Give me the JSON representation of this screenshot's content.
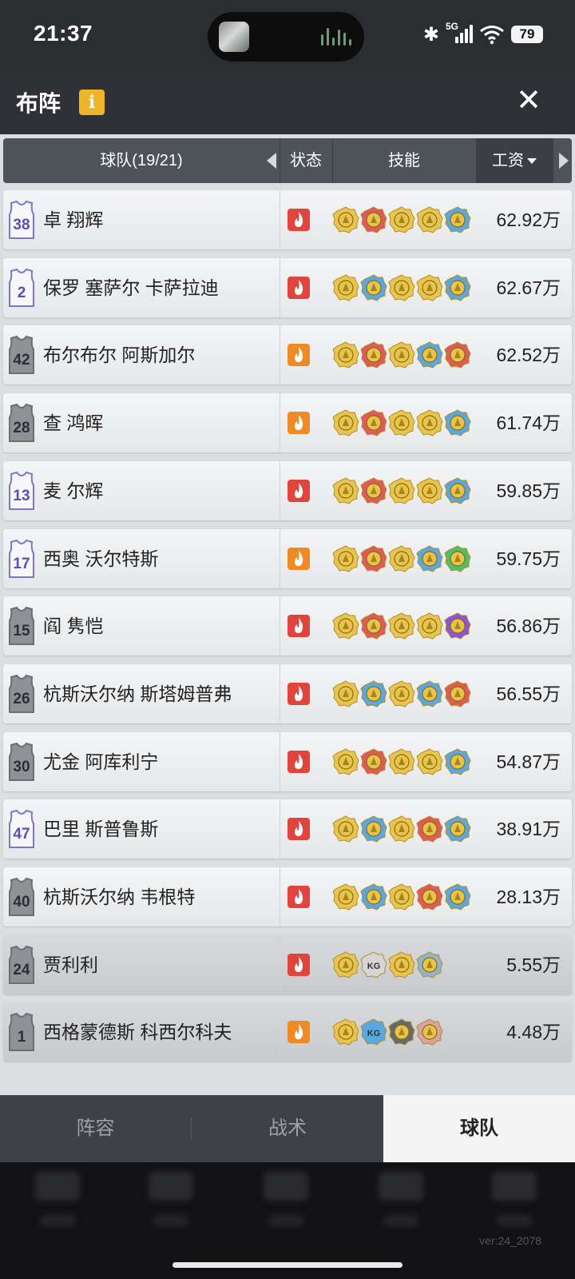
{
  "status": {
    "time": "21:37",
    "network": "5G",
    "battery": "79"
  },
  "header": {
    "title": "布阵",
    "info_label": "i"
  },
  "columns": {
    "team": "球队(19/21)",
    "state": "状态",
    "skill": "技能",
    "salary": "工资"
  },
  "players": [
    {
      "number": "38",
      "jersey": "white",
      "name": "卓 翔辉",
      "state": "red",
      "skills": [
        "gold",
        "red",
        "gold",
        "gold",
        "blue"
      ],
      "salary": "62.92万",
      "dim": false
    },
    {
      "number": "2",
      "jersey": "white",
      "name": "保罗 塞萨尔 卡萨拉迪",
      "state": "red",
      "skills": [
        "gold",
        "blue",
        "gold",
        "gold",
        "blue"
      ],
      "salary": "62.67万",
      "dim": false
    },
    {
      "number": "42",
      "jersey": "gray",
      "name": "布尔布尔 阿斯加尔",
      "state": "orange",
      "skills": [
        "gold",
        "red",
        "gold",
        "blue",
        "red"
      ],
      "salary": "62.52万",
      "dim": false
    },
    {
      "number": "28",
      "jersey": "gray",
      "name": "查 鸿晖",
      "state": "orange",
      "skills": [
        "gold",
        "red",
        "gold",
        "gold",
        "blue"
      ],
      "salary": "61.74万",
      "dim": false
    },
    {
      "number": "13",
      "jersey": "white",
      "name": "麦 尔辉",
      "state": "red",
      "skills": [
        "gold",
        "red",
        "gold",
        "gold",
        "blue"
      ],
      "salary": "59.85万",
      "dim": false
    },
    {
      "number": "17",
      "jersey": "white",
      "name": "西奥 沃尔特斯",
      "state": "orange",
      "skills": [
        "gold",
        "red",
        "gold",
        "blue",
        "green"
      ],
      "salary": "59.75万",
      "dim": false
    },
    {
      "number": "15",
      "jersey": "gray",
      "name": "阎 隽恺",
      "state": "red",
      "skills": [
        "gold",
        "red",
        "gold",
        "gold",
        "purple"
      ],
      "salary": "56.86万",
      "dim": false
    },
    {
      "number": "26",
      "jersey": "gray",
      "name": "杭斯沃尔纳 斯塔姆普弗",
      "state": "red",
      "skills": [
        "gold",
        "blue",
        "gold",
        "blue",
        "red"
      ],
      "salary": "56.55万",
      "dim": false
    },
    {
      "number": "30",
      "jersey": "gray",
      "name": "尤金 阿库利宁",
      "state": "red",
      "skills": [
        "gold",
        "red",
        "gold",
        "gold",
        "blue"
      ],
      "salary": "54.87万",
      "dim": false
    },
    {
      "number": "47",
      "jersey": "white",
      "name": "巴里 斯普鲁斯",
      "state": "red",
      "skills": [
        "gold",
        "blue",
        "gold",
        "red",
        "blue"
      ],
      "salary": "38.91万",
      "dim": false
    },
    {
      "number": "40",
      "jersey": "gray",
      "name": "杭斯沃尔纳 韦根特",
      "state": "red",
      "skills": [
        "gold",
        "blue",
        "gold",
        "red",
        "blue"
      ],
      "salary": "28.13万",
      "dim": false
    },
    {
      "number": "24",
      "jersey": "gray",
      "name": "贾利利",
      "state": "red",
      "skills": [
        "gold",
        "kg-silver",
        "gold",
        "blue-gray"
      ],
      "salary": "5.55万",
      "dim": true
    },
    {
      "number": "1",
      "jersey": "gray",
      "name": "西格蒙德斯 科西尔科夫",
      "state": "orange",
      "skills": [
        "gold",
        "kg-blue",
        "dark",
        "red-gray"
      ],
      "salary": "4.48万",
      "dim": true
    }
  ],
  "tabs": [
    {
      "label": "阵容",
      "active": false
    },
    {
      "label": "战术",
      "active": false
    },
    {
      "label": "球队",
      "active": true
    }
  ],
  "version": "ver:24_2078",
  "colors": {
    "state_red": "#e0443c",
    "state_orange": "#f08a24",
    "skill_gold": "#e7c552",
    "skill_red": "#e05a5a",
    "skill_blue": "#5aa8e0",
    "skill_green": "#4fc06a",
    "skill_purple": "#8a55d6",
    "accent": "#f0b429"
  }
}
